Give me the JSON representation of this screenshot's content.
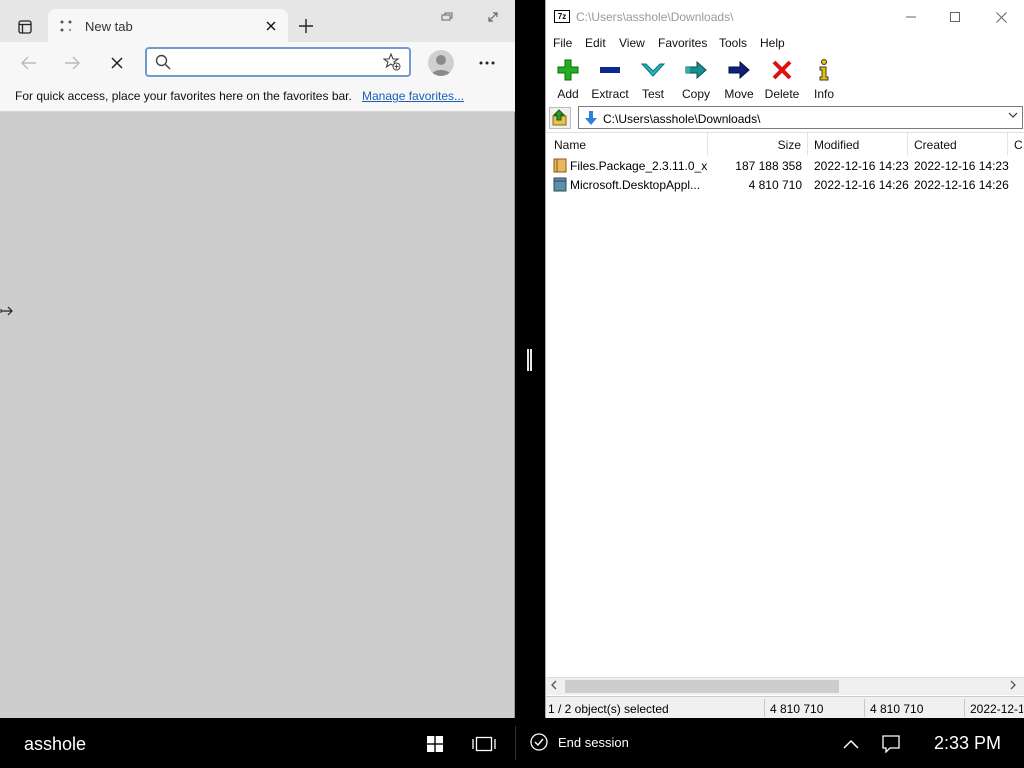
{
  "browser": {
    "tab_title": "New tab",
    "address_placeholder": "",
    "favbar_message": "For quick access, place your favorites here on the favorites bar.",
    "favbar_link": "Manage favorites..."
  },
  "sevenzip": {
    "title": "C:\\Users\\asshole\\Downloads\\",
    "app_icon_text": "7z",
    "menu": [
      "File",
      "Edit",
      "View",
      "Favorites",
      "Tools",
      "Help"
    ],
    "toolbar": {
      "add": "Add",
      "extract": "Extract",
      "test": "Test",
      "copy": "Copy",
      "move": "Move",
      "delete": "Delete",
      "info": "Info"
    },
    "path": "C:\\Users\\asshole\\Downloads\\",
    "columns": {
      "name": "Name",
      "size": "Size",
      "modified": "Modified",
      "created": "Created",
      "extra": "C"
    },
    "files": [
      {
        "name": "Files.Package_2.3.11.0_x...",
        "size": "187 188 358",
        "modified": "2022-12-16 14:23",
        "created": "2022-12-16 14:23"
      },
      {
        "name": "Microsoft.DesktopAppl...",
        "size": "4 810 710",
        "modified": "2022-12-16 14:26",
        "created": "2022-12-16 14:26"
      }
    ],
    "status": {
      "selection": "1 / 2 object(s) selected",
      "size1": "4 810 710",
      "size2": "4 810 710",
      "date": "2022-12-1"
    }
  },
  "taskbar": {
    "user": "asshole",
    "end_session": "End session",
    "clock": "2:33 PM"
  },
  "colors": {
    "accent_link": "#1a5fb4",
    "add_green": "#22b022",
    "extract_blue": "#0b2a8c",
    "test_teal": "#21b8c4",
    "copy_teal": "#1a8f8f",
    "move_navy": "#10207a",
    "delete_red": "#dd1111",
    "info_yellow": "#e8c400"
  }
}
